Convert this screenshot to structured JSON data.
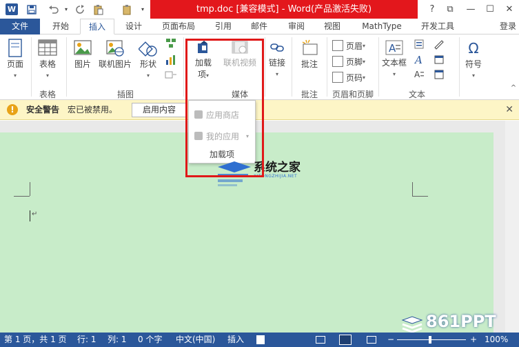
{
  "window": {
    "title": "tmp.doc [兼容模式] - Word(产品激活失败)",
    "logo": "W",
    "qat": {
      "save_icon": "save-icon",
      "undo_icon": "undo-icon",
      "redo_icon": "redo-icon",
      "paste_icon": "clipboard-icon",
      "customize_icon": "chevron-down-icon"
    },
    "controls": {
      "help": "?",
      "restore": "⧉",
      "minimize": "—",
      "maximize": "☐",
      "close": "✕"
    }
  },
  "tabs": {
    "file": "文件",
    "items": [
      "开始",
      "插入",
      "设计",
      "页面布局",
      "引用",
      "邮件",
      "审阅",
      "视图",
      "MathType",
      "开发工具"
    ],
    "active": "插入",
    "login": "登录"
  },
  "ribbon": {
    "page_btn": "页面",
    "table_btn": "表格",
    "table_group": "表格",
    "picture_btn": "图片",
    "online_picture_btn": "联机图片",
    "shapes_btn": "形状",
    "illustration_group": "插图",
    "addins_btn_line1": "加载",
    "addins_btn_line2": "项",
    "online_video_btn": "联机视频",
    "media_group": "媒体",
    "link_btn": "链接",
    "comment_btn": "批注",
    "comment_group": "批注",
    "header_btn": "页眉",
    "footer_btn": "页脚",
    "pagenum_btn": "页码",
    "header_footer_group": "页眉和页脚",
    "textbox_btn": "文本框",
    "text_group": "文本",
    "symbol_btn": "符号",
    "symbol_glyph": "Ω",
    "caret": "▾"
  },
  "security": {
    "title": "安全警告",
    "message": "宏已被禁用。",
    "button": "启用内容",
    "close": "✕",
    "icon": "!"
  },
  "dropdown": {
    "store": "应用商店",
    "my_apps": "我的应用",
    "footer": "加载项"
  },
  "document": {
    "para_mark": "↵"
  },
  "watermarks": {
    "top": "系统之家",
    "top_sub": "XITONGZHIJIA.NET",
    "bottom": "861PPT"
  },
  "status": {
    "page": "第 1 页，共 1 页",
    "line": "行: 1",
    "col": "列: 1",
    "chars": "0 个字",
    "lang": "中文(中国)",
    "mode": "插入",
    "zoom": "100%",
    "zoom_minus": "−",
    "zoom_plus": "+"
  },
  "colors": {
    "word_blue": "#2b579a",
    "title_red": "#e3171c",
    "highlight_red": "#e01818",
    "page_green": "#c8ecc9",
    "warning_yellow": "#fdf5c6"
  }
}
